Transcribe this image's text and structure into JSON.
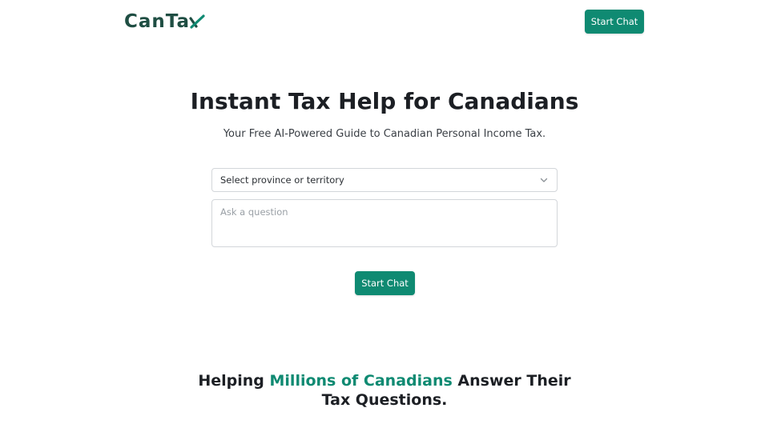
{
  "header": {
    "logo_text": "CanTa",
    "logo_mark_icon": "x-check-mark",
    "start_chat_label": "Start Chat"
  },
  "hero": {
    "title": "Instant Tax Help for Canadians",
    "subtitle": "Your Free AI-Powered Guide to Canadian Personal Income Tax."
  },
  "form": {
    "province_select": {
      "selected": "Select province or territory",
      "icon": "chevron-down-icon"
    },
    "question": {
      "placeholder": "Ask a question",
      "value": ""
    },
    "start_chat_label": "Start Chat"
  },
  "stats": {
    "prefix": "Helping ",
    "highlight": "Millions of Canadians",
    "suffix": " Answer Their Tax Questions."
  },
  "colors": {
    "brand": "#0f8a72",
    "logo": "#1f4e43",
    "text": "#1c1f24"
  }
}
